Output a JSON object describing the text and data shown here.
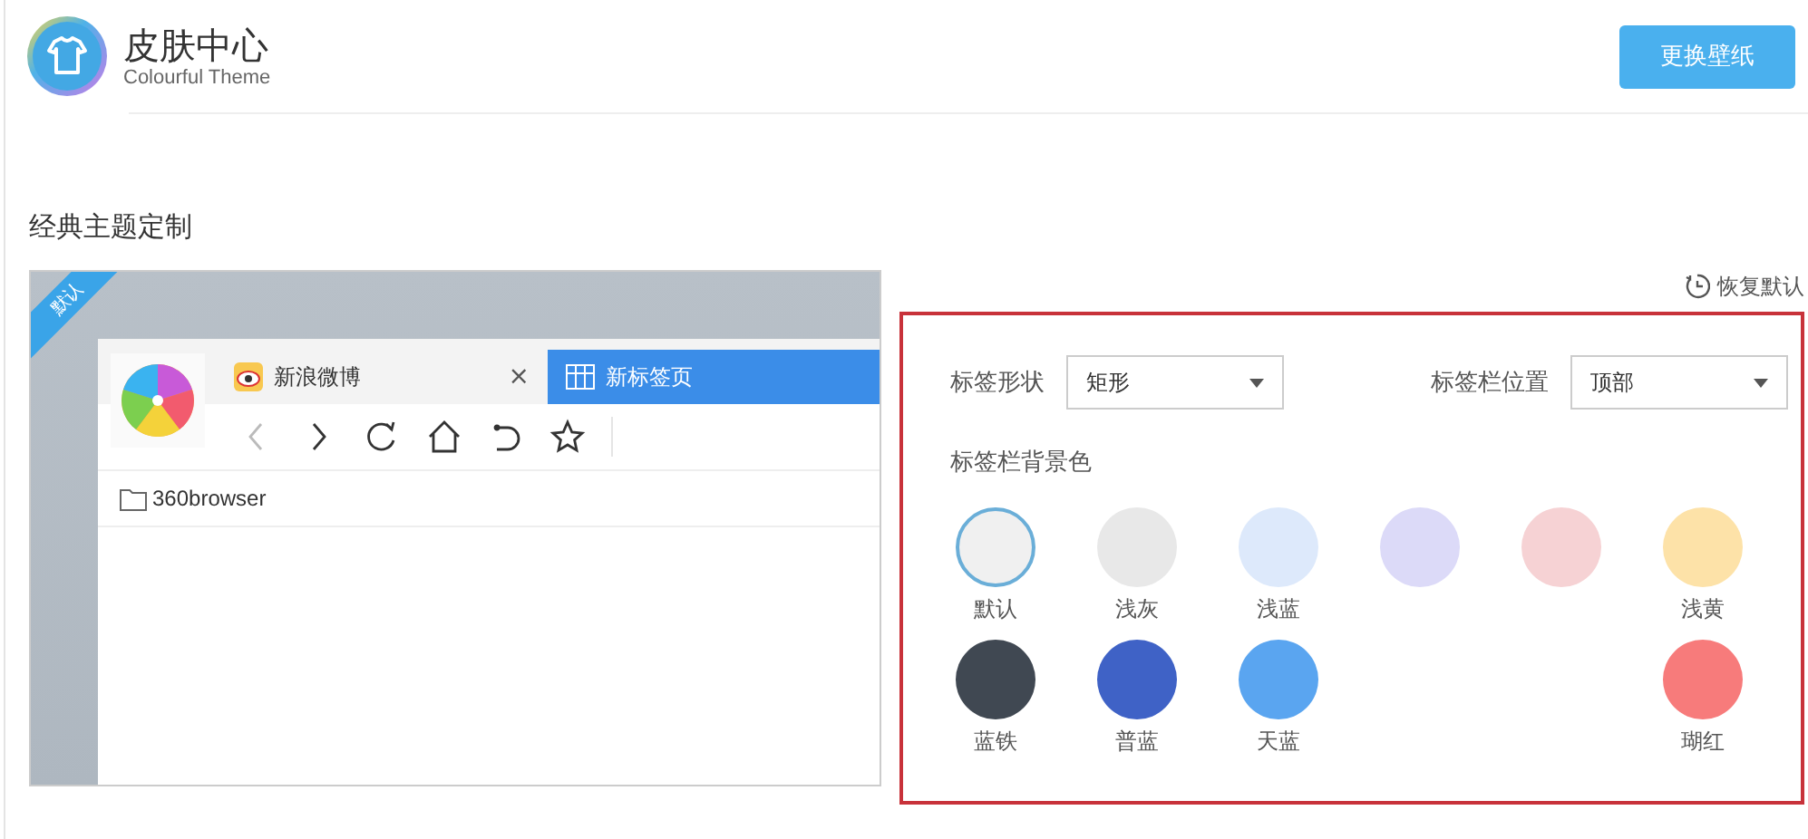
{
  "header": {
    "title": "皮肤中心",
    "subtitle": "Colourful Theme",
    "button": "更换壁纸"
  },
  "section_title": "经典主题定制",
  "preview": {
    "badge": "默认",
    "tabs": [
      {
        "label": "新浪微博",
        "close": "×",
        "selected": false
      },
      {
        "label": "新标签页",
        "selected": true
      }
    ],
    "bookmark": "360browser"
  },
  "restore": "恢复默认",
  "settings": {
    "tab_shape": {
      "label": "标签形状",
      "value": "矩形"
    },
    "tab_position": {
      "label": "标签栏位置",
      "value": "顶部"
    },
    "bg_label": "标签栏背景色",
    "colors": [
      {
        "label": "默认",
        "color": "#f0f0f0",
        "selected": true
      },
      {
        "label": "浅灰",
        "color": "#e8e8e8",
        "selected": false
      },
      {
        "label": "浅蓝",
        "color": "#dde9fb",
        "selected": false
      },
      {
        "color": "#dcdaf8",
        "selected": false
      },
      {
        "color": "#f6d2d4",
        "selected": false
      },
      {
        "label": "浅黄",
        "color": "#fde2a8",
        "selected": false
      }
    ],
    "colors_row2": [
      {
        "label": "蓝铁",
        "color": "#404852",
        "selected": false
      },
      {
        "label": "普蓝",
        "color": "#3f62c6",
        "selected": false
      },
      {
        "label": "天蓝",
        "color": "#5aa5f0",
        "selected": false
      },
      {
        "label": "瑚红",
        "color": "#f77b7b",
        "selected": false
      }
    ]
  }
}
